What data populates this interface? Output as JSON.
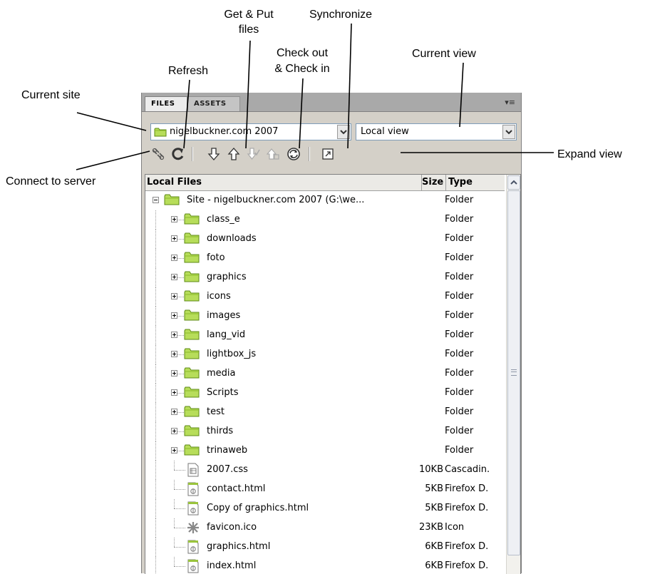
{
  "callouts": {
    "get_put": "Get & Put\nfiles",
    "get_put_line1": "Get & Put",
    "get_put_line2": "files",
    "synchronize": "Synchronize",
    "check_line1": "Check out",
    "check_line2": "& Check in",
    "current_view": "Current view",
    "refresh": "Refresh",
    "current_site": "Current site",
    "connect": "Connect to server",
    "expand": "Expand view"
  },
  "panel": {
    "tabs": [
      {
        "label": "FILES",
        "active": true
      },
      {
        "label": "ASSETS",
        "active": false
      }
    ],
    "menu_icon": "options-menu-icon",
    "site_select": {
      "value": "nigelbuckner.com 2007",
      "icon": "folder-icon"
    },
    "view_select": {
      "value": "Local view"
    },
    "toolbar": [
      {
        "name": "connect-icon",
        "enabled": true
      },
      {
        "name": "refresh-icon",
        "enabled": true
      },
      {
        "name": "get-icon",
        "enabled": true
      },
      {
        "name": "put-icon",
        "enabled": true
      },
      {
        "name": "checkout-icon",
        "enabled": false
      },
      {
        "name": "checkin-icon",
        "enabled": false
      },
      {
        "name": "synchronize-icon",
        "enabled": true
      },
      {
        "name": "expand-icon",
        "enabled": true
      }
    ]
  },
  "filelist": {
    "columns": {
      "name": "Local Files",
      "size": "Size",
      "type": "Type"
    },
    "root": {
      "name": "Site - nigelbuckner.com 2007 (G:\\we...",
      "type": "Folder"
    },
    "folders": [
      {
        "name": "class_e",
        "type": "Folder"
      },
      {
        "name": "downloads",
        "type": "Folder"
      },
      {
        "name": "foto",
        "type": "Folder"
      },
      {
        "name": "graphics",
        "type": "Folder"
      },
      {
        "name": "icons",
        "type": "Folder"
      },
      {
        "name": "images",
        "type": "Folder"
      },
      {
        "name": "lang_vid",
        "type": "Folder"
      },
      {
        "name": "lightbox_js",
        "type": "Folder"
      },
      {
        "name": "media",
        "type": "Folder"
      },
      {
        "name": "Scripts",
        "type": "Folder"
      },
      {
        "name": "test",
        "type": "Folder"
      },
      {
        "name": "thirds",
        "type": "Folder"
      },
      {
        "name": "trinaweb",
        "type": "Folder"
      }
    ],
    "files": [
      {
        "name": "2007.css",
        "size": "10KB",
        "type": "Cascadin.",
        "icon": "css-file-icon"
      },
      {
        "name": "contact.html",
        "size": "5KB",
        "type": "Firefox D.",
        "icon": "html-file-icon"
      },
      {
        "name": "Copy of graphics.html",
        "size": "5KB",
        "type": "Firefox D.",
        "icon": "html-file-icon"
      },
      {
        "name": "favicon.ico",
        "size": "23KB",
        "type": "Icon",
        "icon": "ico-file-icon"
      },
      {
        "name": "graphics.html",
        "size": "6KB",
        "type": "Firefox D.",
        "icon": "html-file-icon"
      },
      {
        "name": "index.html",
        "size": "6KB",
        "type": "Firefox D.",
        "icon": "html-file-icon"
      }
    ]
  },
  "colors": {
    "folder": "#a8d24a",
    "panel_bg": "#d4d0c8",
    "header_bg": "#ebeae6"
  }
}
